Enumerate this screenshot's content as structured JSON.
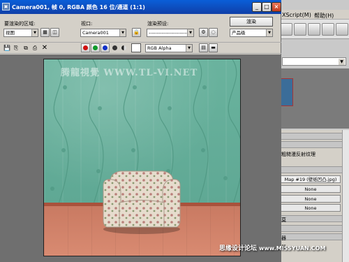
{
  "window": {
    "title": "Camera001, 帧 0, RGBA 颜色 16 位/通道 (1:1)",
    "min_glyph": "_",
    "max_glyph": "□",
    "close_glyph": "×"
  },
  "controls": {
    "area_label": "要渲染的区域:",
    "area_value": "视图",
    "viewport_label": "视口:",
    "viewport_value": "Camera001",
    "preset_label": "渲染预设:",
    "preset_value": "------------------------",
    "render_button": "渲染",
    "quality_value": "产品级",
    "channel_value": "RGB Alpha"
  },
  "background_app": {
    "menu_script": "XScript(M)",
    "menu_help": "帮助(H)",
    "material_label": "粗糙漫反射纹理",
    "map_button": "Map #19 (壁纸凹凸.jpg)",
    "none_buttons": [
      "None",
      "None",
      "None"
    ],
    "side_letters": [
      "莫",
      "器",
      "器"
    ]
  },
  "render": {
    "watermark": "腾龍視覺 WWW.TL-VI.NET"
  },
  "credit": {
    "cn": "思缘设计论坛",
    "en": "www.MISSYUAN.COM"
  },
  "colors": {
    "wall": "#62ad98",
    "floor": "#d48670",
    "titlebar": "#0a5fd8",
    "channel_red": "#d01010",
    "channel_green": "#0e9a2a",
    "channel_blue": "#1030c8"
  }
}
